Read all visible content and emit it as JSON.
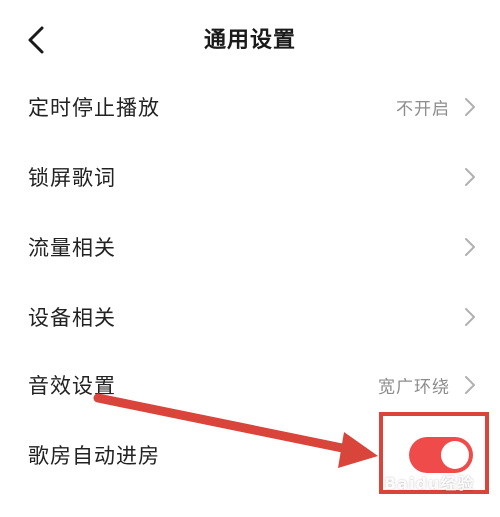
{
  "header": {
    "title": "通用设置",
    "back_icon": "chevron-left-icon"
  },
  "settings": [
    {
      "label": "定时停止播放",
      "value": "不开启"
    },
    {
      "label": "锁屏歌词",
      "value": ""
    },
    {
      "label": "流量相关",
      "value": ""
    },
    {
      "label": "设备相关",
      "value": ""
    },
    {
      "label": "音效设置",
      "value": "宽广环绕"
    },
    {
      "label": "歌房自动进房",
      "toggle_on": true
    }
  ],
  "colors": {
    "toggle_on": "#ee4b4a",
    "annotation": "#d9443b",
    "value_text": "#8c8c8c"
  },
  "watermark": "Baidu经验"
}
